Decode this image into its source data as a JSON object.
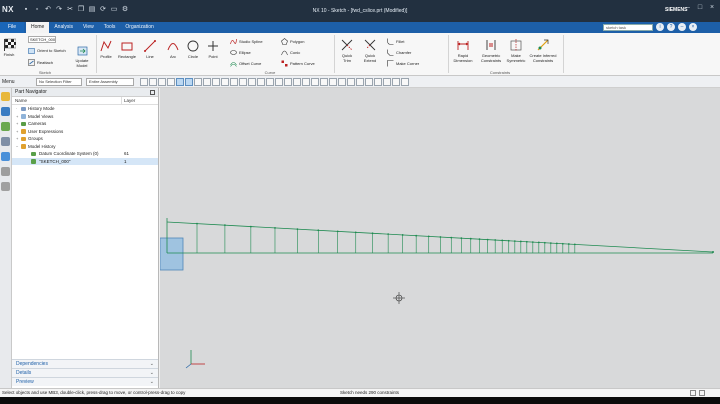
{
  "app": {
    "logo": "NX",
    "title": "NX 10 - Sketch - [fwd_cslice.prt (Modified)]",
    "brand": "SIEMENS"
  },
  "tabs": {
    "file": "File",
    "items": [
      "Home",
      "Analysis",
      "View",
      "Tools",
      "Organization"
    ],
    "active_index": 0,
    "search_text": "sketch task"
  },
  "ribbon": {
    "sketch_dropdown": "SKETCH_000",
    "finish": "Finish",
    "orient": "Orient to Sketch",
    "reattach": "Reattach",
    "update_model": "Update Model",
    "group_sketch": "Sketch",
    "curve_buttons": [
      "Profile",
      "Rectangle",
      "Line",
      "Arc",
      "Circle",
      "Point"
    ],
    "curve_small": [
      "Studio Spline",
      "Ellipse",
      "Offset Curve"
    ],
    "curve_small2": [
      "Polygon",
      "Conic",
      "Pattern Curve"
    ],
    "group_curve": "Curve",
    "edit_buttons": [
      "Quick Trim",
      "Quick Extend"
    ],
    "edit_small": [
      "Fillet",
      "Chamfer",
      "Make Corner"
    ],
    "constraint_buttons": [
      "Rapid Dimension",
      "Geometric Constraints",
      "Make Symmetric",
      "Create Inferred Constraints"
    ],
    "group_constraints": "Constraints"
  },
  "seltool": {
    "menu": "Menu",
    "filter1": "No Selection Filter",
    "filter2": "Entire Assembly"
  },
  "navigator": {
    "title": "Part Navigator",
    "col_name": "Name",
    "col_layer": "Layer",
    "rows": [
      {
        "label": "History Mode",
        "layer": ""
      },
      {
        "label": "Model Views",
        "layer": ""
      },
      {
        "label": "Cameras",
        "layer": ""
      },
      {
        "label": "User Expressions",
        "layer": ""
      },
      {
        "label": "Groups",
        "layer": ""
      },
      {
        "label": "Model History",
        "layer": ""
      },
      {
        "label": "Datum Coordinate System (0)",
        "layer": "61"
      },
      {
        "label": "\"SKETCH_000\"",
        "layer": "1"
      }
    ],
    "panels": [
      "Dependencies",
      "Details",
      "Preview"
    ]
  },
  "status": {
    "left": "Select objects and use MB3, double-click, press-drag to move, or control-press-drag to copy",
    "mid": "Sketch needs 290 constraints"
  },
  "colors": {
    "titlebar": "#223040",
    "tabbar": "#1d5fa8",
    "sketch": "#1e8a50",
    "viewport": "#d8d9da"
  }
}
